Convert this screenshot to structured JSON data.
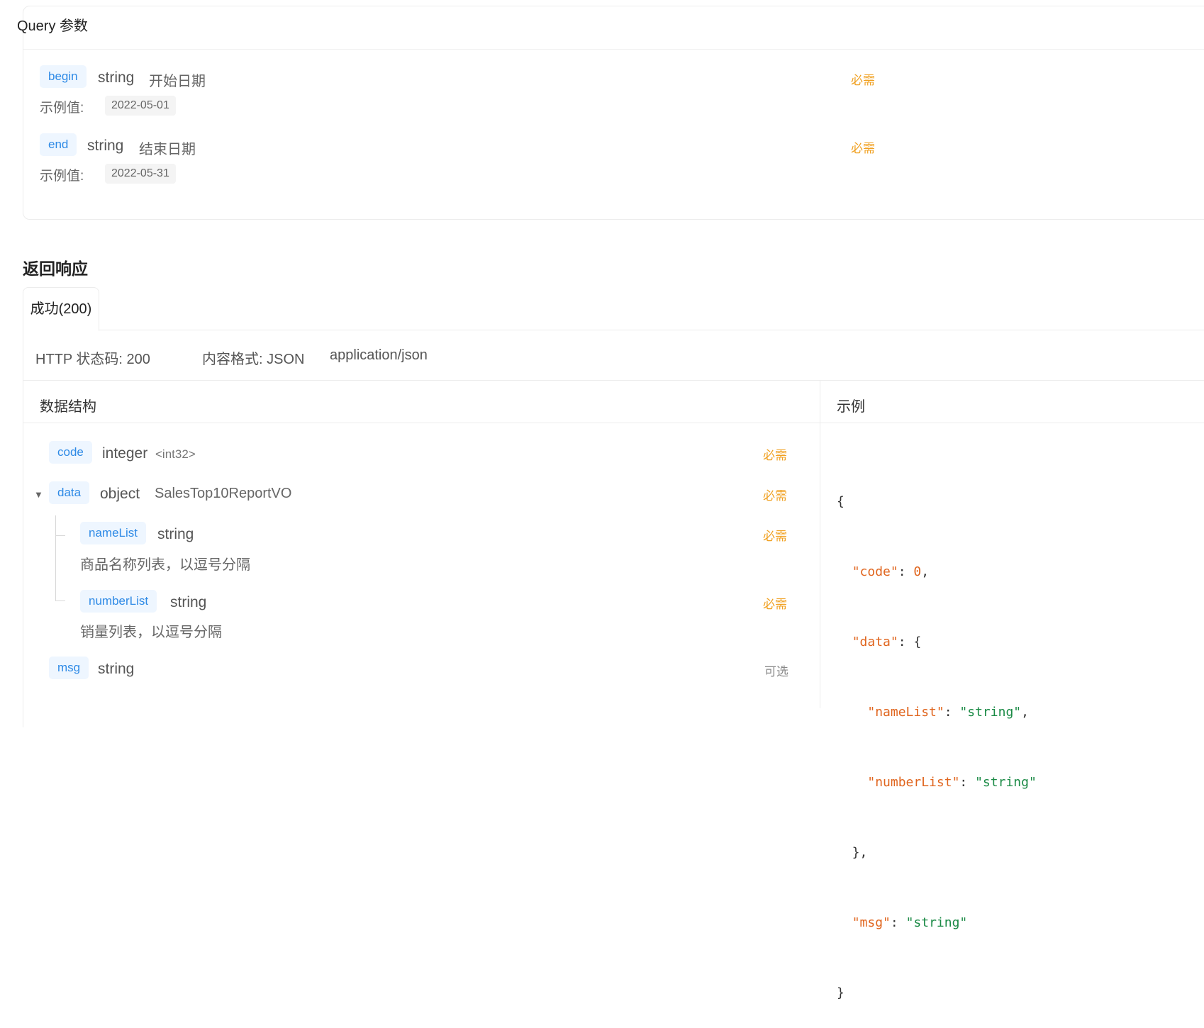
{
  "query": {
    "title": "Query 参数",
    "params": [
      {
        "name": "begin",
        "type": "string",
        "desc": "开始日期",
        "status": "必需",
        "example_label": "示例值:",
        "example": "2022-05-01"
      },
      {
        "name": "end",
        "type": "string",
        "desc": "结束日期",
        "status": "必需",
        "example_label": "示例值:",
        "example": "2022-05-31"
      }
    ]
  },
  "response": {
    "section_title": "返回响应",
    "tab_label": "成功(200)",
    "http_status": "HTTP 状态码: 200",
    "content_format": "内容格式: JSON",
    "mime": "application/json",
    "schema_header": "数据结构",
    "example_header": "示例",
    "fields": {
      "code": {
        "name": "code",
        "type": "integer",
        "format": "<int32>",
        "status": "必需"
      },
      "data": {
        "name": "data",
        "type": "object",
        "ref": "SalesTop10ReportVO",
        "status": "必需"
      },
      "nameList": {
        "name": "nameList",
        "type": "string",
        "status": "必需",
        "desc": "商品名称列表，以逗号分隔"
      },
      "numberList": {
        "name": "numberList",
        "type": "string",
        "status": "必需",
        "desc": "销量列表，以逗号分隔"
      },
      "msg": {
        "name": "msg",
        "type": "string",
        "status": "可选"
      }
    },
    "example_lines": [
      "{",
      "  \"code\": 0,",
      "  \"data\": {",
      "    \"nameList\": \"string\",",
      "    \"numberList\": \"string\"",
      "  },",
      "  \"msg\": \"string\"",
      "}"
    ]
  }
}
